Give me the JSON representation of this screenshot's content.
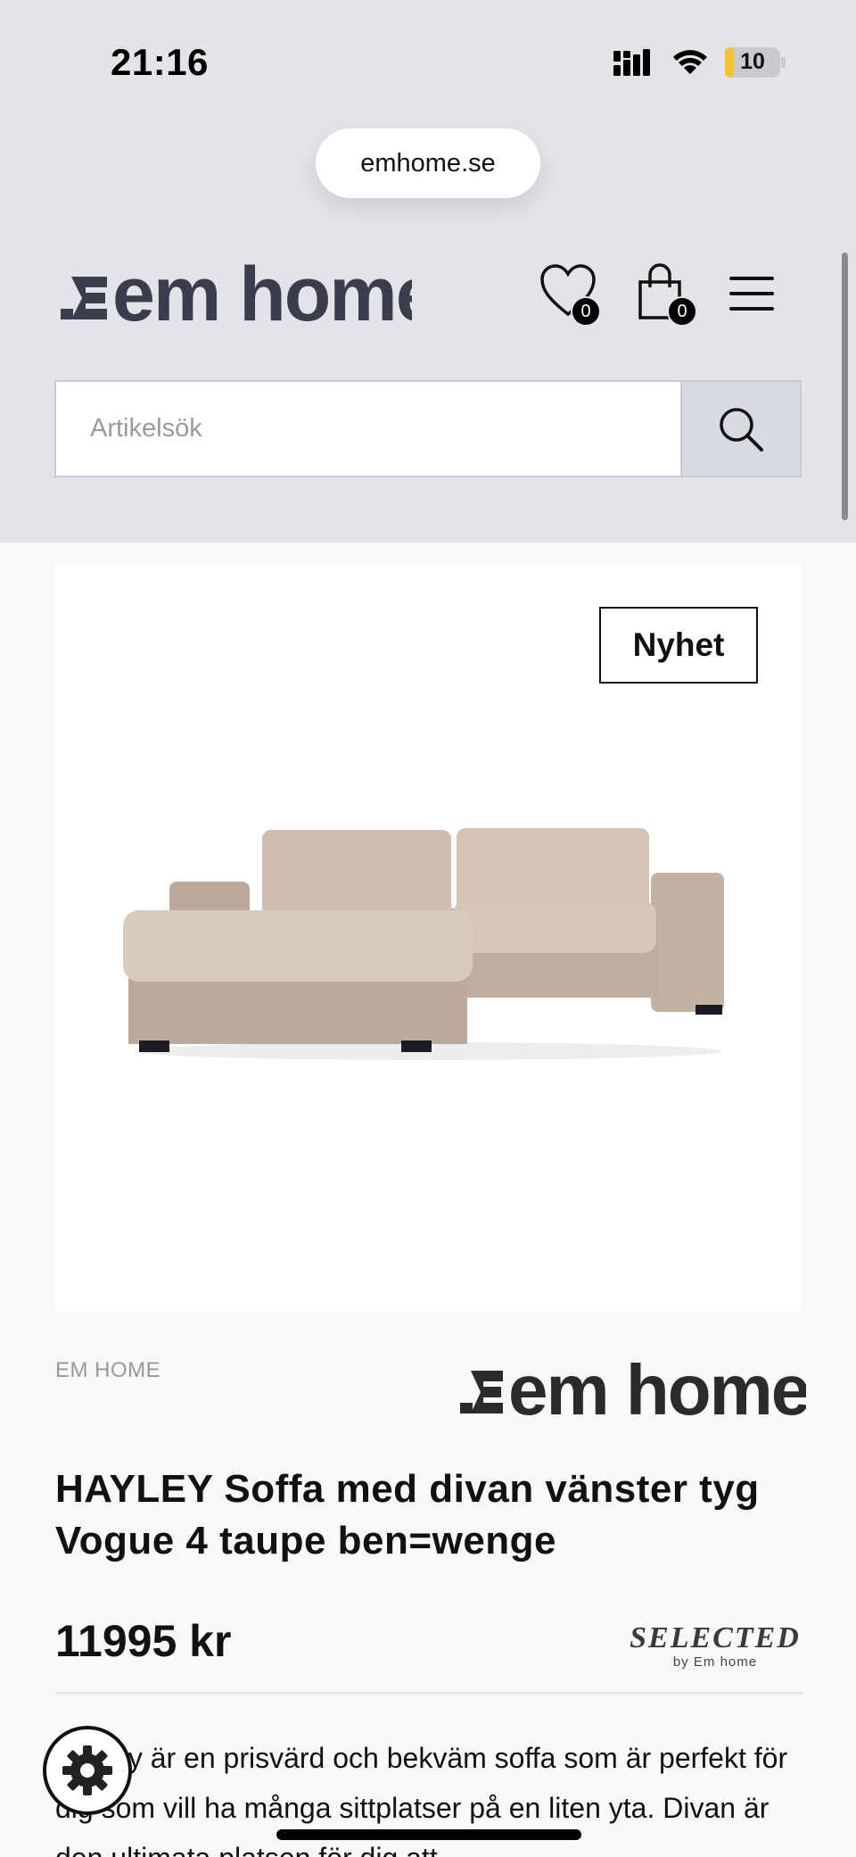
{
  "status_bar": {
    "time": "21:16",
    "battery": "10"
  },
  "browser": {
    "url": "emhome.se"
  },
  "header": {
    "logo_text": "em home",
    "wishlist_count": "0",
    "cart_count": "0",
    "icons": [
      "heart-icon",
      "shopping-bag-icon",
      "hamburger-menu-icon",
      "search-icon"
    ]
  },
  "search": {
    "placeholder": "Artikelsök",
    "value": ""
  },
  "product": {
    "badge": "Nyhet",
    "brand": "EM HOME",
    "brand_logo_text": "em home",
    "title": "HAYLEY Soffa med divan vänster tyg Vogue 4 taupe ben=wenge",
    "price": "11995 kr",
    "collection_logo": {
      "word": "SELECTED",
      "sub": "by Em home"
    },
    "description": "Hayley är en prisvärd och bekväm soffa som är perfekt för dig som vill ha många sittplatser på en liten yta. Divan är den ultimata platsen för dig att"
  },
  "colors": {
    "header_bg": "#e3e4e8",
    "page_bg": "#f8f8f8",
    "logo": "#3a3d4c",
    "text": "#111111"
  }
}
